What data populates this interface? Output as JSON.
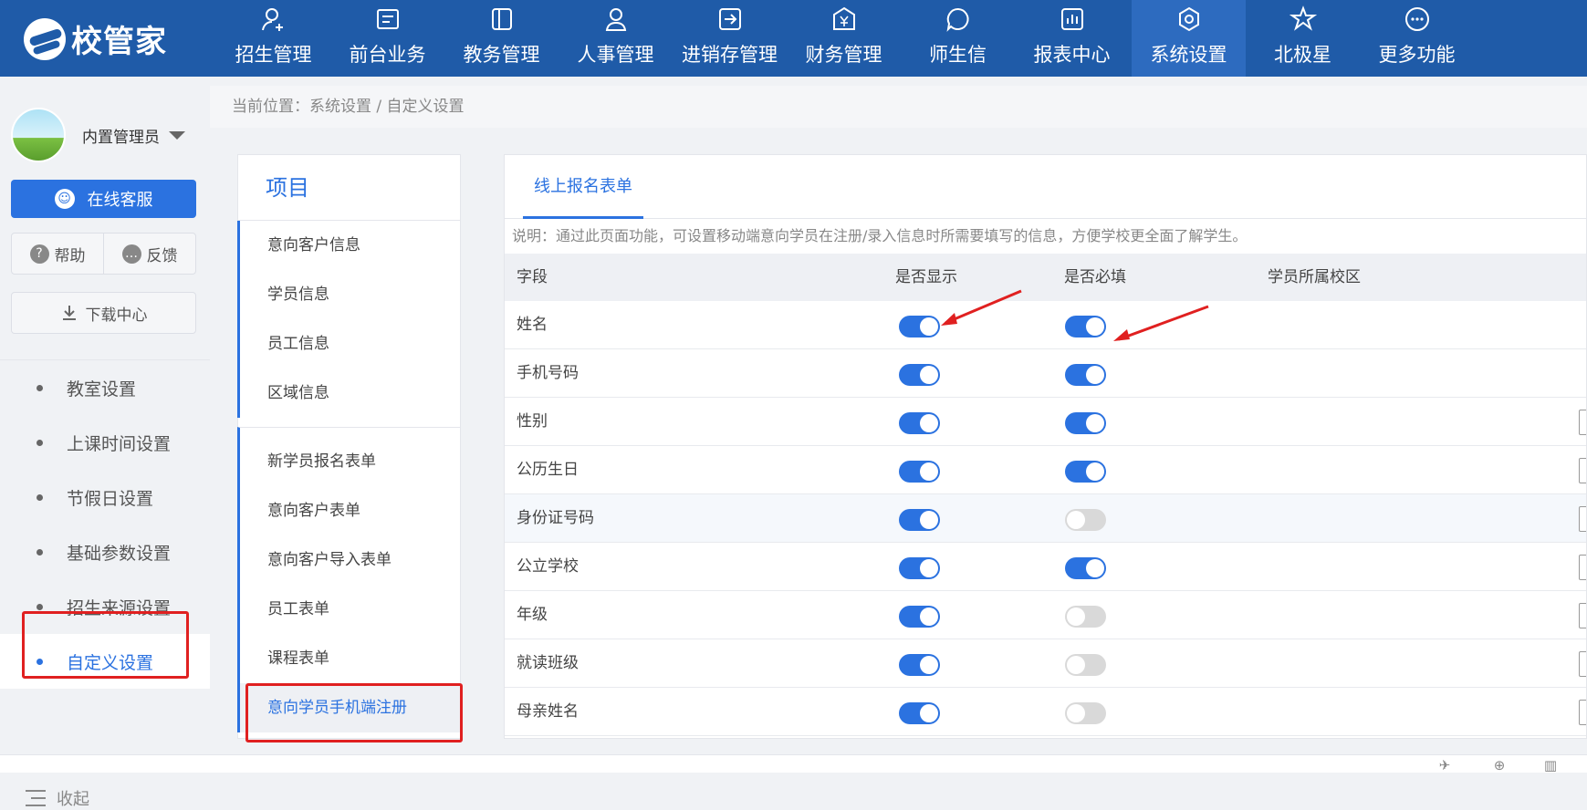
{
  "app": {
    "name": "校管家"
  },
  "nav": [
    {
      "label": "招生管理",
      "icon": "person-add-icon"
    },
    {
      "label": "前台业务",
      "icon": "form-icon"
    },
    {
      "label": "教务管理",
      "icon": "book-icon"
    },
    {
      "label": "人事管理",
      "icon": "person-icon"
    },
    {
      "label": "进销存管理",
      "icon": "box-arrow-icon"
    },
    {
      "label": "财务管理",
      "icon": "yen-icon"
    },
    {
      "label": "师生信",
      "icon": "chat-icon"
    },
    {
      "label": "报表中心",
      "icon": "bar-chart-icon"
    },
    {
      "label": "系统设置",
      "icon": "gear-icon",
      "active": true
    },
    {
      "label": "北极星",
      "icon": "star-icon"
    },
    {
      "label": "更多功能",
      "icon": "more-icon"
    }
  ],
  "sidebar": {
    "user": "内置管理员",
    "service": "在线客服",
    "help": "帮助",
    "feedback": "反馈",
    "download": "下载中心",
    "menu": [
      {
        "label": "教室设置"
      },
      {
        "label": "上课时间设置"
      },
      {
        "label": "节假日设置"
      },
      {
        "label": "基础参数设置"
      },
      {
        "label": "招生来源设置"
      },
      {
        "label": "自定义设置",
        "active": true
      }
    ],
    "collapse": "收起"
  },
  "breadcrumb": "当前位置：系统设置 / 自定义设置",
  "projects": {
    "title": "项目",
    "group1": [
      "意向客户信息",
      "学员信息",
      "员工信息",
      "区域信息"
    ],
    "group2": [
      "新学员报名表单",
      "意向客户表单",
      "意向客户导入表单",
      "员工表单",
      "课程表单",
      "意向学员手机端注册"
    ],
    "active": "意向学员手机端注册"
  },
  "form": {
    "tab": "线上报名表单",
    "description": "说明：通过此页面功能，可设置移动端意向学员在注册/录入信息时所需要填写的信息，方便学校更全面了解学生。",
    "columns": [
      "字段",
      "是否显示",
      "是否必填",
      "学员所属校区"
    ],
    "rows": [
      {
        "field": "姓名",
        "show": true,
        "required": true
      },
      {
        "field": "手机号码",
        "show": true,
        "required": true
      },
      {
        "field": "性别",
        "show": true,
        "required": true
      },
      {
        "field": "公历生日",
        "show": true,
        "required": true
      },
      {
        "field": "身份证号码",
        "show": true,
        "required": false
      },
      {
        "field": "公立学校",
        "show": true,
        "required": true
      },
      {
        "field": "年级",
        "show": true,
        "required": false
      },
      {
        "field": "就读班级",
        "show": true,
        "required": false
      },
      {
        "field": "母亲姓名",
        "show": true,
        "required": false
      }
    ]
  },
  "colors": {
    "accent": "#2b72e0",
    "topbar": "#1f5ba8",
    "highlight": "#e02020"
  }
}
